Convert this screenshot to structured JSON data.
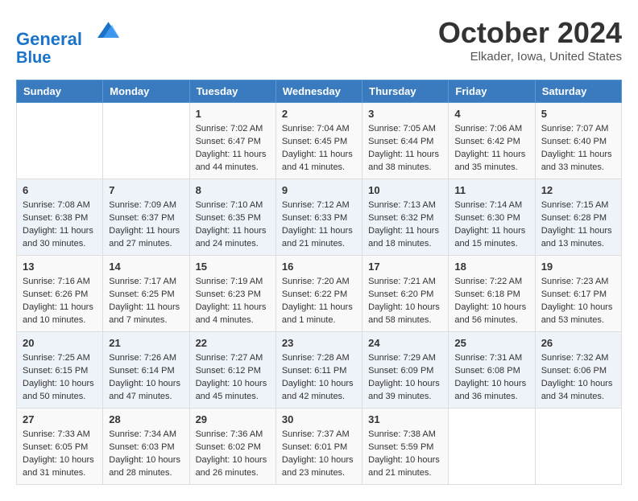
{
  "header": {
    "logo_line1": "General",
    "logo_line2": "Blue",
    "month": "October 2024",
    "location": "Elkader, Iowa, United States"
  },
  "days_of_week": [
    "Sunday",
    "Monday",
    "Tuesday",
    "Wednesday",
    "Thursday",
    "Friday",
    "Saturday"
  ],
  "weeks": [
    [
      {
        "day": "",
        "info": ""
      },
      {
        "day": "",
        "info": ""
      },
      {
        "day": "1",
        "info": "Sunrise: 7:02 AM\nSunset: 6:47 PM\nDaylight: 11 hours and 44 minutes."
      },
      {
        "day": "2",
        "info": "Sunrise: 7:04 AM\nSunset: 6:45 PM\nDaylight: 11 hours and 41 minutes."
      },
      {
        "day": "3",
        "info": "Sunrise: 7:05 AM\nSunset: 6:44 PM\nDaylight: 11 hours and 38 minutes."
      },
      {
        "day": "4",
        "info": "Sunrise: 7:06 AM\nSunset: 6:42 PM\nDaylight: 11 hours and 35 minutes."
      },
      {
        "day": "5",
        "info": "Sunrise: 7:07 AM\nSunset: 6:40 PM\nDaylight: 11 hours and 33 minutes."
      }
    ],
    [
      {
        "day": "6",
        "info": "Sunrise: 7:08 AM\nSunset: 6:38 PM\nDaylight: 11 hours and 30 minutes."
      },
      {
        "day": "7",
        "info": "Sunrise: 7:09 AM\nSunset: 6:37 PM\nDaylight: 11 hours and 27 minutes."
      },
      {
        "day": "8",
        "info": "Sunrise: 7:10 AM\nSunset: 6:35 PM\nDaylight: 11 hours and 24 minutes."
      },
      {
        "day": "9",
        "info": "Sunrise: 7:12 AM\nSunset: 6:33 PM\nDaylight: 11 hours and 21 minutes."
      },
      {
        "day": "10",
        "info": "Sunrise: 7:13 AM\nSunset: 6:32 PM\nDaylight: 11 hours and 18 minutes."
      },
      {
        "day": "11",
        "info": "Sunrise: 7:14 AM\nSunset: 6:30 PM\nDaylight: 11 hours and 15 minutes."
      },
      {
        "day": "12",
        "info": "Sunrise: 7:15 AM\nSunset: 6:28 PM\nDaylight: 11 hours and 13 minutes."
      }
    ],
    [
      {
        "day": "13",
        "info": "Sunrise: 7:16 AM\nSunset: 6:26 PM\nDaylight: 11 hours and 10 minutes."
      },
      {
        "day": "14",
        "info": "Sunrise: 7:17 AM\nSunset: 6:25 PM\nDaylight: 11 hours and 7 minutes."
      },
      {
        "day": "15",
        "info": "Sunrise: 7:19 AM\nSunset: 6:23 PM\nDaylight: 11 hours and 4 minutes."
      },
      {
        "day": "16",
        "info": "Sunrise: 7:20 AM\nSunset: 6:22 PM\nDaylight: 11 hours and 1 minute."
      },
      {
        "day": "17",
        "info": "Sunrise: 7:21 AM\nSunset: 6:20 PM\nDaylight: 10 hours and 58 minutes."
      },
      {
        "day": "18",
        "info": "Sunrise: 7:22 AM\nSunset: 6:18 PM\nDaylight: 10 hours and 56 minutes."
      },
      {
        "day": "19",
        "info": "Sunrise: 7:23 AM\nSunset: 6:17 PM\nDaylight: 10 hours and 53 minutes."
      }
    ],
    [
      {
        "day": "20",
        "info": "Sunrise: 7:25 AM\nSunset: 6:15 PM\nDaylight: 10 hours and 50 minutes."
      },
      {
        "day": "21",
        "info": "Sunrise: 7:26 AM\nSunset: 6:14 PM\nDaylight: 10 hours and 47 minutes."
      },
      {
        "day": "22",
        "info": "Sunrise: 7:27 AM\nSunset: 6:12 PM\nDaylight: 10 hours and 45 minutes."
      },
      {
        "day": "23",
        "info": "Sunrise: 7:28 AM\nSunset: 6:11 PM\nDaylight: 10 hours and 42 minutes."
      },
      {
        "day": "24",
        "info": "Sunrise: 7:29 AM\nSunset: 6:09 PM\nDaylight: 10 hours and 39 minutes."
      },
      {
        "day": "25",
        "info": "Sunrise: 7:31 AM\nSunset: 6:08 PM\nDaylight: 10 hours and 36 minutes."
      },
      {
        "day": "26",
        "info": "Sunrise: 7:32 AM\nSunset: 6:06 PM\nDaylight: 10 hours and 34 minutes."
      }
    ],
    [
      {
        "day": "27",
        "info": "Sunrise: 7:33 AM\nSunset: 6:05 PM\nDaylight: 10 hours and 31 minutes."
      },
      {
        "day": "28",
        "info": "Sunrise: 7:34 AM\nSunset: 6:03 PM\nDaylight: 10 hours and 28 minutes."
      },
      {
        "day": "29",
        "info": "Sunrise: 7:36 AM\nSunset: 6:02 PM\nDaylight: 10 hours and 26 minutes."
      },
      {
        "day": "30",
        "info": "Sunrise: 7:37 AM\nSunset: 6:01 PM\nDaylight: 10 hours and 23 minutes."
      },
      {
        "day": "31",
        "info": "Sunrise: 7:38 AM\nSunset: 5:59 PM\nDaylight: 10 hours and 21 minutes."
      },
      {
        "day": "",
        "info": ""
      },
      {
        "day": "",
        "info": ""
      }
    ]
  ]
}
